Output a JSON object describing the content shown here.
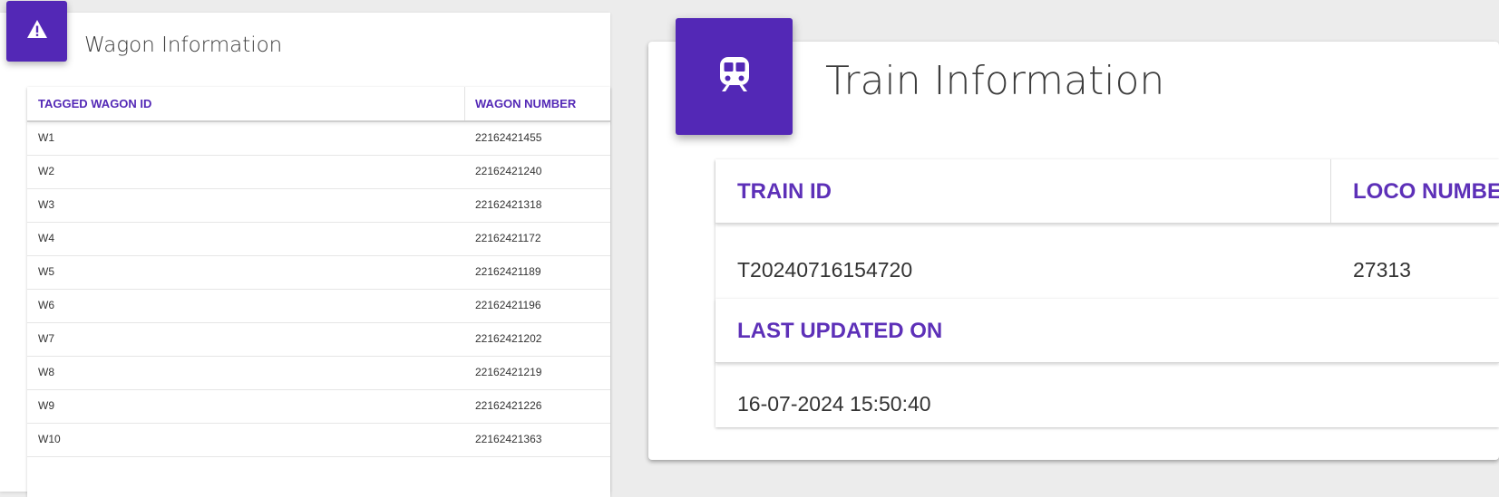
{
  "wagon_panel": {
    "title": "Wagon Information",
    "icon": "warning-icon",
    "columns": [
      "TAGGED WAGON ID",
      "WAGON NUMBER"
    ],
    "rows": [
      {
        "id": "W1",
        "number": "22162421455"
      },
      {
        "id": "W2",
        "number": "22162421240"
      },
      {
        "id": "W3",
        "number": "22162421318"
      },
      {
        "id": "W4",
        "number": "22162421172"
      },
      {
        "id": "W5",
        "number": "22162421189"
      },
      {
        "id": "W6",
        "number": "22162421196"
      },
      {
        "id": "W7",
        "number": "22162421202"
      },
      {
        "id": "W8",
        "number": "22162421219"
      },
      {
        "id": "W9",
        "number": "22162421226"
      },
      {
        "id": "W10",
        "number": "22162421363"
      }
    ]
  },
  "train_panel": {
    "title": "Train Information",
    "icon": "train-icon",
    "labels": {
      "train_id": "TRAIN ID",
      "loco_number": "LOCO NUMBE",
      "last_updated": "LAST UPDATED ON"
    },
    "values": {
      "train_id": "T20240716154720",
      "loco_number": "27313",
      "last_updated": "16-07-2024 15:50:40"
    }
  },
  "colors": {
    "accent": "#5328b6",
    "label_purple": "#5d30b8",
    "background": "#ececec"
  }
}
